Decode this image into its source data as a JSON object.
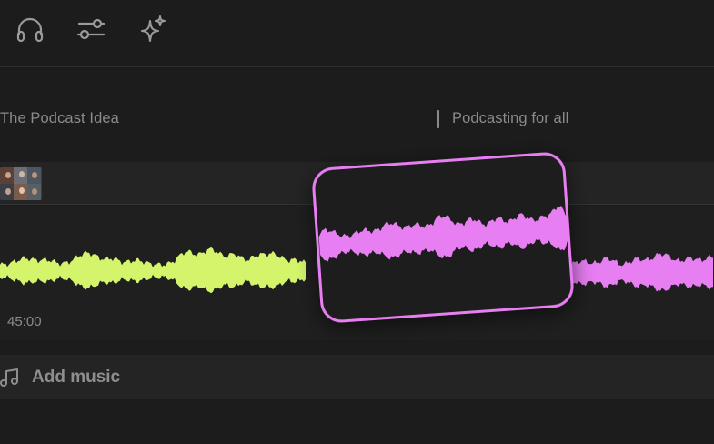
{
  "toolbar": {
    "icons": [
      "headphones-icon",
      "sliders-icon",
      "sparkle-icon"
    ]
  },
  "chapters": {
    "first": "The Podcast Idea",
    "second": "Podcasting for all"
  },
  "timeline": {
    "timestamp": "45:00",
    "add_music_label": "Add music"
  },
  "colors": {
    "background": "#1c1c1c",
    "waveform_primary": "#d4f56b",
    "waveform_selected": "#e77ef2",
    "selection_border": "#e77ef2"
  }
}
